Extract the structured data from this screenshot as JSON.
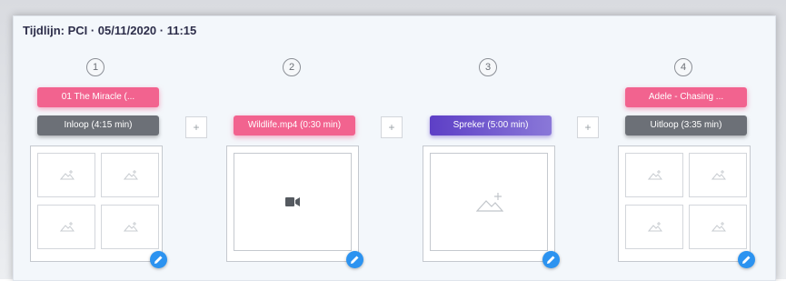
{
  "title": "Tijdlijn: PCI · 05/11/2020 · 11:15",
  "columns": [
    {
      "number": "1",
      "song": "01 The Miracle (...",
      "segment": "Inloop (4:15 min)",
      "segment_style": "gray",
      "media": "image-grid"
    },
    {
      "number": "2",
      "song": "",
      "segment": "Wildlife.mp4 (0:30 min)",
      "segment_style": "pink",
      "media": "video"
    },
    {
      "number": "3",
      "song": "",
      "segment": "Spreker (5:00 min)",
      "segment_style": "purple",
      "media": "image"
    },
    {
      "number": "4",
      "song": "Adele - Chasing ...",
      "segment": "Uitloop (3:35 min)",
      "segment_style": "gray",
      "media": "image-grid"
    }
  ],
  "add_buttons": [
    "+",
    "+",
    "+"
  ],
  "colors": {
    "pink": "#f2638f",
    "gray": "#6c7077",
    "purple": "#5d3fc6",
    "edit_blue": "#2c93f0"
  },
  "icons": {
    "media_placeholder": "image-add-icon",
    "video": "video-camera-icon",
    "edit": "pencil-icon"
  }
}
